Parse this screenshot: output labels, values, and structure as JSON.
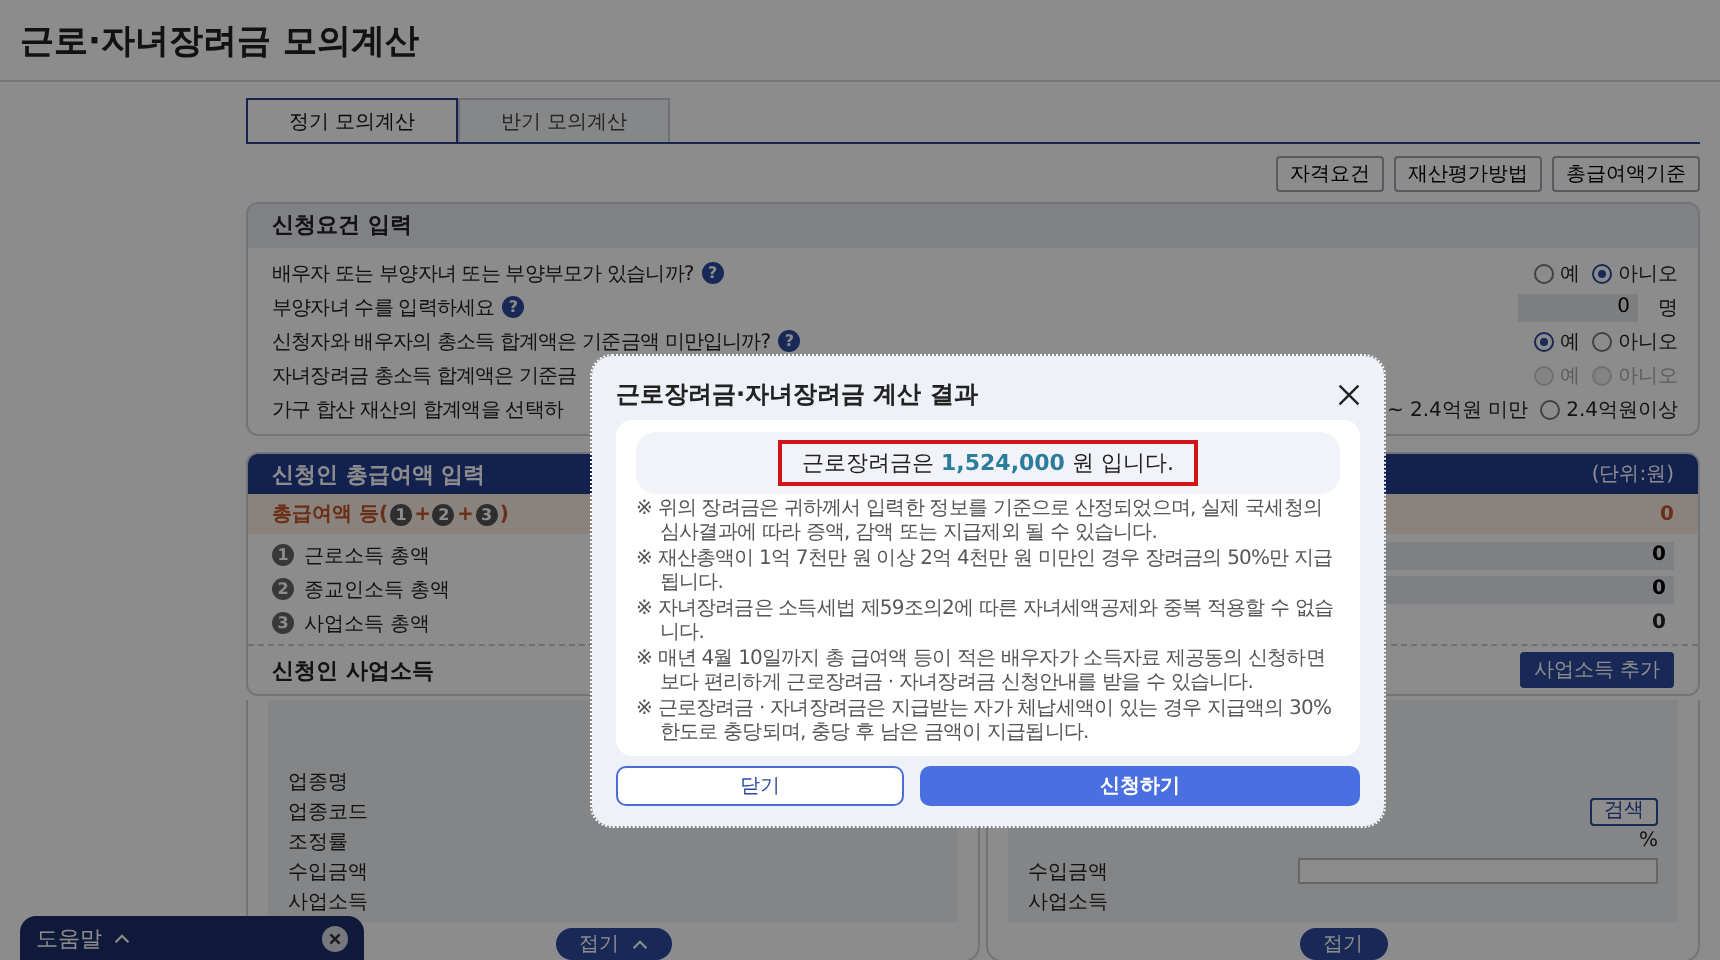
{
  "page_title": "근로·자녀장려금 모의계산",
  "tabs": [
    {
      "label": "정기 모의계산",
      "selected": true
    },
    {
      "label": "반기 모의계산",
      "selected": false
    }
  ],
  "info_buttons": [
    "자격요건",
    "재산평가방법",
    "총급여액기준"
  ],
  "requirements": {
    "title": "신청요건 입력",
    "rows": [
      {
        "kind": "radio",
        "question": "배우자 또는 부양자녀 또는 부양부모가 있습니까?",
        "help": "?",
        "disabled": false,
        "options": [
          {
            "label": "예",
            "selected": false
          },
          {
            "label": "아니오",
            "selected": true
          }
        ]
      },
      {
        "kind": "number",
        "question": "부양자녀 수를 입력하세요",
        "help": "?",
        "value": "0",
        "unit": "명"
      },
      {
        "kind": "radio",
        "question": "신청자와 배우자의 총소득 합계액은 기준금액 미만입니까?",
        "help": "?",
        "disabled": false,
        "options": [
          {
            "label": "예",
            "selected": true
          },
          {
            "label": "아니오",
            "selected": false
          }
        ]
      },
      {
        "kind": "radio",
        "question": "자녀장려금 총소득 합계액은 기준금",
        "disabled": true,
        "options": [
          {
            "label": "예",
            "selected": false
          },
          {
            "label": "아니오",
            "selected": false
          }
        ]
      },
      {
        "kind": "radio",
        "question": "가구 합산 재산의 합계액을 선택하",
        "disabled": false,
        "options": [
          {
            "label": "~ 2.4억원 미만",
            "partial": true
          },
          {
            "label": "2.4억원이상",
            "selected": false
          }
        ]
      }
    ]
  },
  "income": {
    "title": "신청인 총급여액 입력",
    "unit": "(단위:원)",
    "total": {
      "prefix": "총급여액 등(",
      "terms": [
        "1",
        "2",
        "3"
      ],
      "joiner": "+",
      "suffix": ")",
      "value": "0"
    },
    "items": [
      {
        "number": "1",
        "label": "근로소득 총액",
        "value": "0",
        "kind": "input"
      },
      {
        "number": "2",
        "label": "종교인소득 총액",
        "value": "0",
        "kind": "input"
      },
      {
        "number": "3",
        "label": "사업소득 총액",
        "value": "0",
        "kind": "plain"
      }
    ],
    "business": {
      "title": "신청인 사업소득",
      "add_button": "사업소득 추가",
      "cards": [
        {
          "rows": [
            {
              "kind": "text",
              "label": "업종명"
            },
            {
              "kind": "text",
              "label": "업종코드"
            },
            {
              "kind": "text",
              "label": "조정률"
            },
            {
              "kind": "text",
              "label": "수입금액"
            },
            {
              "kind": "text",
              "label": "사업소득"
            }
          ],
          "collapse": "접기",
          "caret": true
        },
        {
          "rows": [
            {
              "kind": "search",
              "button": "검색"
            },
            {
              "kind": "unit",
              "unit": "%"
            },
            {
              "kind": "input",
              "label": "수입금액"
            },
            {
              "kind": "text",
              "label": "사업소득"
            }
          ],
          "collapse": "접기",
          "caret": false
        }
      ]
    }
  },
  "help_bar": {
    "label": "도움말"
  },
  "modal": {
    "title": "근로장려금·자녀장려금 계산 결과",
    "result": {
      "prefix": "근로장려금은",
      "amount": "1,524,000",
      "suffix": "원 입니다."
    },
    "notes": [
      "※ 위의 장려금은 귀하께서 입력한 정보를 기준으로 산정되었으며, 실제 국세청의 심사결과에 따라 증액, 감액 또는 지급제외 될 수 있습니다.",
      "※ 재산총액이 1억 7천만 원 이상 2억 4천만 원 미만인 경우 장려금의 50%만 지급됩니다.",
      "※ 자녀장려금은 소득세법 제59조의2에 따른 자녀세액공제와 중복 적용할 수 없습니다.",
      "※ 매년 4월 10일까지 총 급여액 등이 적은 배우자가 소득자료 제공동의 신청하면 보다 편리하게 근로장려금 · 자녀장려금 신청안내를 받을 수 있습니다.",
      "※ 근로장려금 · 자녀장려금은 지급받는 자가 체납세액이 있는 경우 지급액의 30% 한도로 충당되며, 충당 후 남은 금액이 지급됩니다."
    ],
    "buttons": [
      {
        "label": "닫기",
        "kind": "secondary"
      },
      {
        "label": "신청하기",
        "kind": "primary"
      }
    ]
  }
}
